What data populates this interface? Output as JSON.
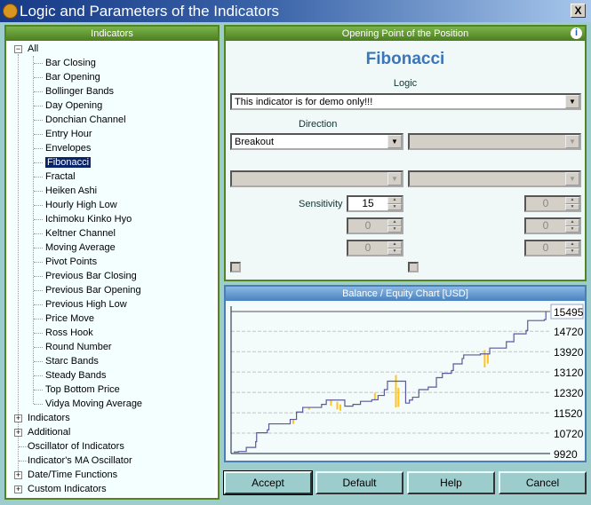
{
  "window": {
    "title": "Logic and Parameters of the Indicators",
    "logo": "S",
    "close": "X"
  },
  "left": {
    "header": "Indicators",
    "root": "All",
    "selected": "Fibonacci",
    "items": [
      "Bar Closing",
      "Bar Opening",
      "Bollinger Bands",
      "Day Opening",
      "Donchian Channel",
      "Entry Hour",
      "Envelopes",
      "Fibonacci",
      "Fractal",
      "Heiken Ashi",
      "Hourly High Low",
      "Ichimoku Kinko Hyo",
      "Keltner Channel",
      "Moving Average",
      "Pivot Points",
      "Previous Bar Closing",
      "Previous Bar Opening",
      "Previous High Low",
      "Price Move",
      "Ross Hook",
      "Round Number",
      "Starc Bands",
      "Steady Bands",
      "Top Bottom Price",
      "Vidya Moving Average"
    ],
    "groups": [
      {
        "label": "Indicators",
        "expandable": true
      },
      {
        "label": "Additional",
        "expandable": true
      },
      {
        "label": "Oscillator of Indicators",
        "expandable": false
      },
      {
        "label": "Indicator's MA Oscillator",
        "expandable": false
      },
      {
        "label": "Date/Time Functions",
        "expandable": true
      },
      {
        "label": "Custom Indicators",
        "expandable": true
      }
    ]
  },
  "right": {
    "header": "Opening Point of the Position",
    "indicator": "Fibonacci",
    "logic_label": "Logic",
    "logic_value": "This indicator is for demo only!!!",
    "direction_label": "Direction",
    "direction_value": "Breakout",
    "sensitivity_label": "Sensitivity",
    "sensitivity_value": "15",
    "disabled_value": "0"
  },
  "chart": {
    "header": "Balance / Equity Chart [USD]",
    "colors": {
      "balance": "#5a5a9a",
      "equity": "#ffc520"
    }
  },
  "buttons": {
    "accept": "Accept",
    "default": "Default",
    "help": "Help",
    "cancel": "Cancel"
  },
  "chart_data": {
    "type": "line",
    "title": "Balance / Equity Chart [USD]",
    "ylim": [
      9920,
      15495
    ],
    "yticks": [
      "15495",
      "14720",
      "13920",
      "13120",
      "12320",
      "11520",
      "10720",
      "9920"
    ],
    "series": [
      {
        "name": "Balance",
        "x": [
          0,
          1.5,
          4,
          7,
          7.3,
          10.7,
          11.2,
          16.5,
          18,
          20,
          22,
          27,
          28,
          29.5,
          32,
          35.4,
          38,
          40.4,
          44,
          46,
          48,
          49,
          51.4,
          54.5,
          54.8,
          56,
          57,
          59,
          62,
          64.6,
          66.5,
          69.4,
          70,
          72.8,
          73.3,
          78.6,
          81.6,
          85.4,
          86.9,
          89.3,
          93.2,
          93.7,
          99,
          99.5
        ],
        "y": [
          9980,
          10000,
          10160,
          10385,
          10735,
          10850,
          11085,
          11085,
          11260,
          11550,
          11730,
          11730,
          11850,
          12020,
          12020,
          11780,
          11850,
          11970,
          12030,
          12200,
          12430,
          12760,
          12760,
          12760,
          11900,
          12020,
          12130,
          12430,
          12530,
          12900,
          13070,
          13180,
          13440,
          13650,
          13790,
          13830,
          14060,
          14060,
          14310,
          14620,
          14750,
          15140,
          15180,
          15495
        ]
      },
      {
        "name": "Equity",
        "dips": [
          [
            19,
            11080,
            11260
          ],
          [
            24,
            11640,
            11730
          ],
          [
            31,
            11800,
            12020
          ],
          [
            33,
            11650,
            11950
          ],
          [
            34,
            11600,
            11850
          ],
          [
            45,
            12000,
            12300
          ],
          [
            51.7,
            11730,
            13000
          ],
          [
            52.5,
            11750,
            12500
          ],
          [
            80,
            13300,
            13980
          ],
          [
            81,
            13450,
            13850
          ]
        ]
      }
    ]
  }
}
